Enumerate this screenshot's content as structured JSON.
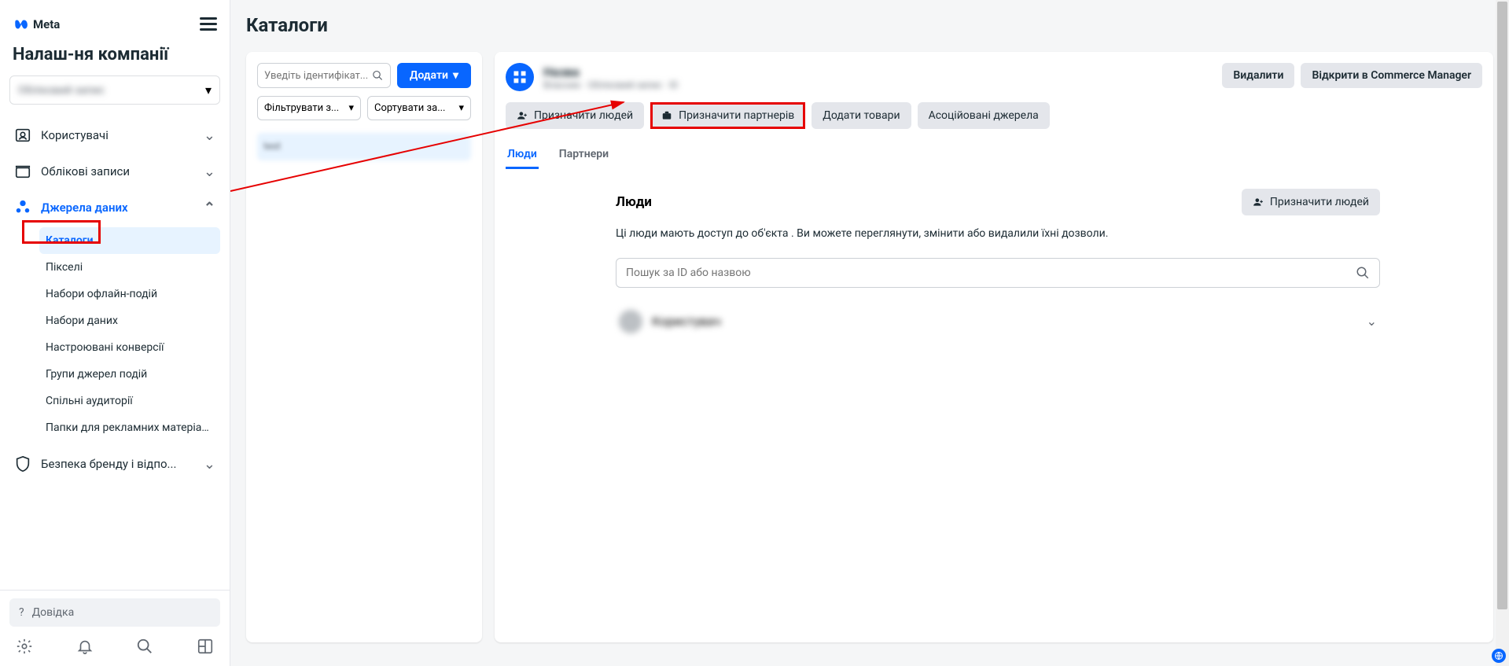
{
  "brand": "Meta",
  "sidebar": {
    "title": "Налаш-ня компанії",
    "account": "Обліковий запис",
    "nav": {
      "users": "Користувачі",
      "accounts": "Облікові записи",
      "data_sources": "Джерела даних",
      "brand_safety": "Безпека бренду і відпо..."
    },
    "sub": {
      "catalogs": "Каталоги",
      "pixels": "Пікселі",
      "offline": "Набори офлайн-подій",
      "datasets": "Набори даних",
      "conversions": "Настроювані конверсії",
      "event_groups": "Групи джерел подій",
      "shared_audiences": "Спільні аудиторії",
      "folders": "Папки для рекламних матеріалів ..."
    },
    "help": "Довідка"
  },
  "main": {
    "title": "Каталоги",
    "search_placeholder": "Увeдіть ідентифікат...",
    "add": "Додати",
    "filter": "Фільтрувати з...",
    "sort": "Сортувати за...",
    "list_item": "test"
  },
  "detail": {
    "name": "Назва",
    "sub": "Власник · Обліковий запис · ID",
    "delete": "Видалити",
    "open_commerce": "Відкрити в Commerce Manager",
    "assign_people": "Призначити людей",
    "assign_partners": "Призначити партнерів",
    "add_products": "Додати товари",
    "associated": "Асоційовані джерела",
    "tabs": {
      "people": "Люди",
      "partners": "Партнери"
    },
    "people_title": "Люди",
    "people_desc_1": "Ці люди мають доступ до об'єкта ",
    "people_desc_blur": "​​​​​​",
    "people_desc_2": ". Ви можете переглянути, змінити або видалили їхні дозволи.",
    "people_search_placeholder": "Пошук за ID або назвою",
    "person": "Користувач"
  }
}
